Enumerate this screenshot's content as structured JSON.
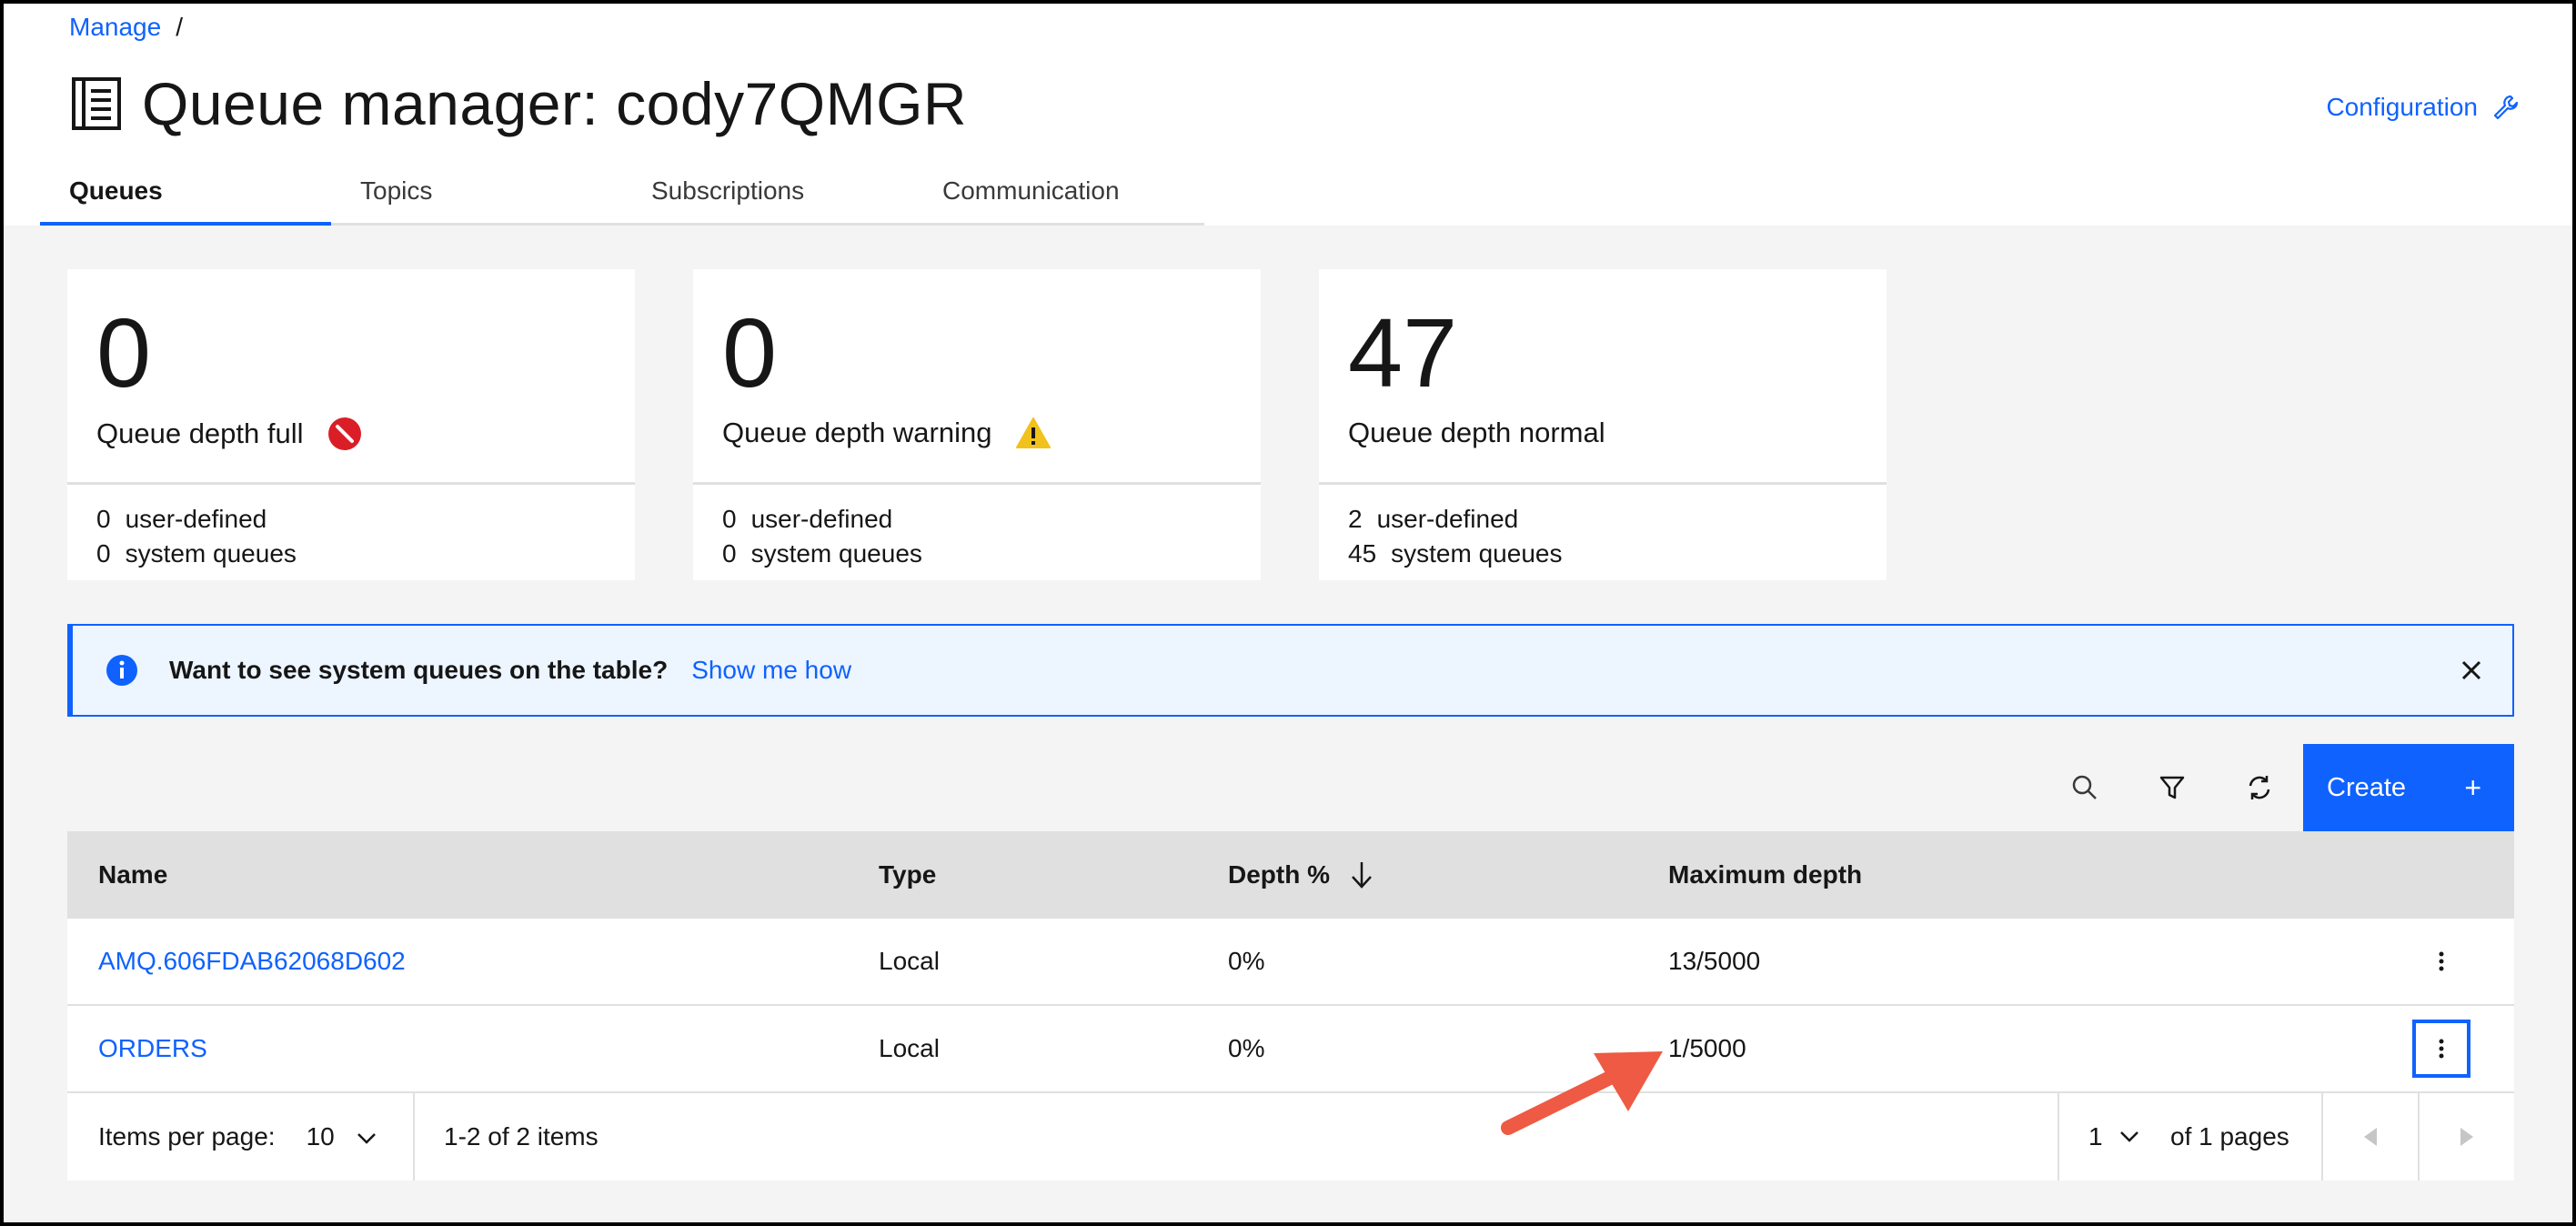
{
  "breadcrumb": {
    "root": "Manage",
    "separator": "/"
  },
  "page": {
    "title": "Queue manager: cody7QMGR",
    "title_icon": "document-list-icon"
  },
  "config": {
    "label": "Configuration",
    "icon": "wrench-icon"
  },
  "tabs": [
    {
      "label": "Queues",
      "active": true
    },
    {
      "label": "Topics",
      "active": false
    },
    {
      "label": "Subscriptions",
      "active": false
    },
    {
      "label": "Communication",
      "active": false
    }
  ],
  "tiles": [
    {
      "value": "0",
      "label": "Queue depth full",
      "status_icon": "error-circle-icon",
      "user_count": "0",
      "user_label": "user-defined",
      "system_count": "0",
      "system_label": "system queues"
    },
    {
      "value": "0",
      "label": "Queue depth warning",
      "status_icon": "warning-triangle-icon",
      "user_count": "0",
      "user_label": "user-defined",
      "system_count": "0",
      "system_label": "system queues"
    },
    {
      "value": "47",
      "label": "Queue depth normal",
      "status_icon": "",
      "user_count": "2",
      "user_label": "user-defined",
      "system_count": "45",
      "system_label": "system queues"
    }
  ],
  "notification": {
    "message": "Want to see system queues on the table?",
    "link": "Show me how",
    "icon": "info-icon"
  },
  "toolbar": {
    "search_icon": "search-icon",
    "filter_icon": "filter-icon",
    "refresh_icon": "refresh-icon",
    "create_label": "Create",
    "create_plus": "+"
  },
  "table": {
    "headers": {
      "name": "Name",
      "type": "Type",
      "depth": "Depth %",
      "max": "Maximum depth"
    },
    "sort_icon": "arrow-down-icon",
    "rows": [
      {
        "name": "AMQ.606FDAB62068D602",
        "type": "Local",
        "depth": "0%",
        "max": "13/5000"
      },
      {
        "name": "ORDERS",
        "type": "Local",
        "depth": "0%",
        "max": "1/5000"
      }
    ]
  },
  "pagination": {
    "items_per_page_label": "Items per page:",
    "items_per_page": "10",
    "range": "1-2 of 2 items",
    "page": "1",
    "of_pages": "of 1 pages"
  },
  "colors": {
    "accent": "#0f62fe",
    "error": "#da1e28",
    "warning": "#f1c21b",
    "annotation_arrow": "#ee5a43"
  }
}
